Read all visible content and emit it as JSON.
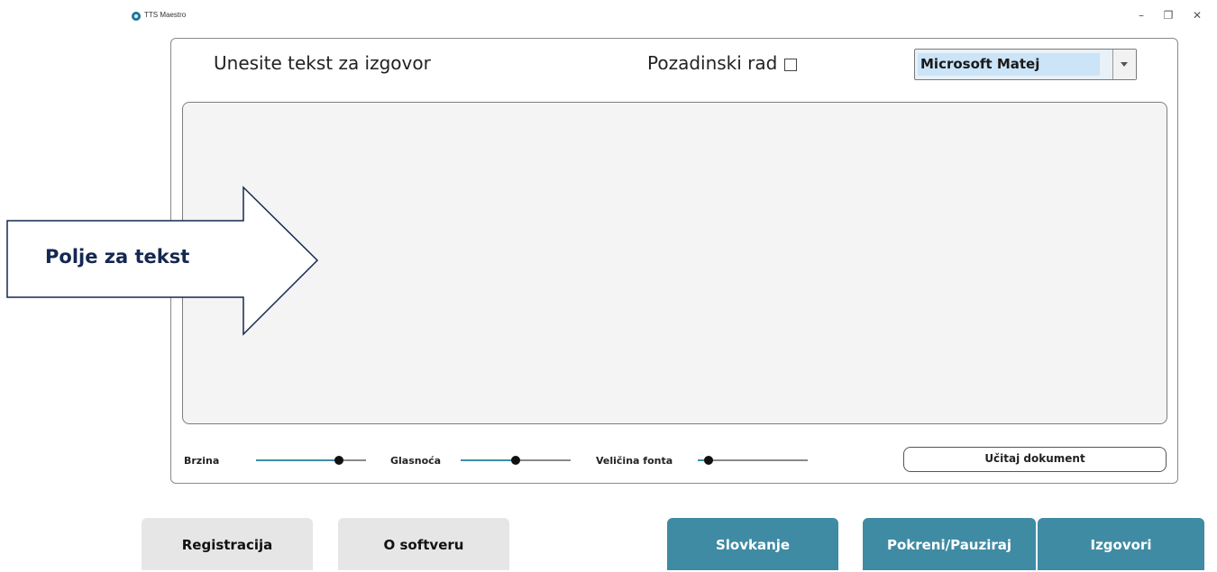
{
  "window": {
    "title": "TTS Maestro",
    "controls": {
      "minimize": "–",
      "maximize": "❐",
      "close": "✕"
    }
  },
  "header": {
    "prompt_label": "Unesite tekst za izgovor",
    "background_mode_label": "Pozadinski rad",
    "background_mode_checked": false,
    "voice_selected": "Microsoft Matej"
  },
  "text_field": {
    "value": ""
  },
  "annotation": {
    "label": "Polje za tekst"
  },
  "sliders": [
    {
      "label": "Brzina",
      "value_fraction": 0.75
    },
    {
      "label": "Glasnoća",
      "value_fraction": 0.5
    },
    {
      "label": "Veličina fonta",
      "value_fraction": 0.1
    }
  ],
  "load_document_button": "Učitaj dokument",
  "buttons": {
    "register": "Registracija",
    "about": "O softveru",
    "spell": "Slovkanje",
    "start_pause": "Pokreni/Pauziraj",
    "speak": "Izgovori"
  },
  "colors": {
    "accent": "#3f8ba3",
    "annotation_text": "#142850",
    "selection": "#cce4f7"
  },
  "icons": {
    "app": "tts-maestro-icon",
    "dropdown": "chevron-down-icon"
  }
}
